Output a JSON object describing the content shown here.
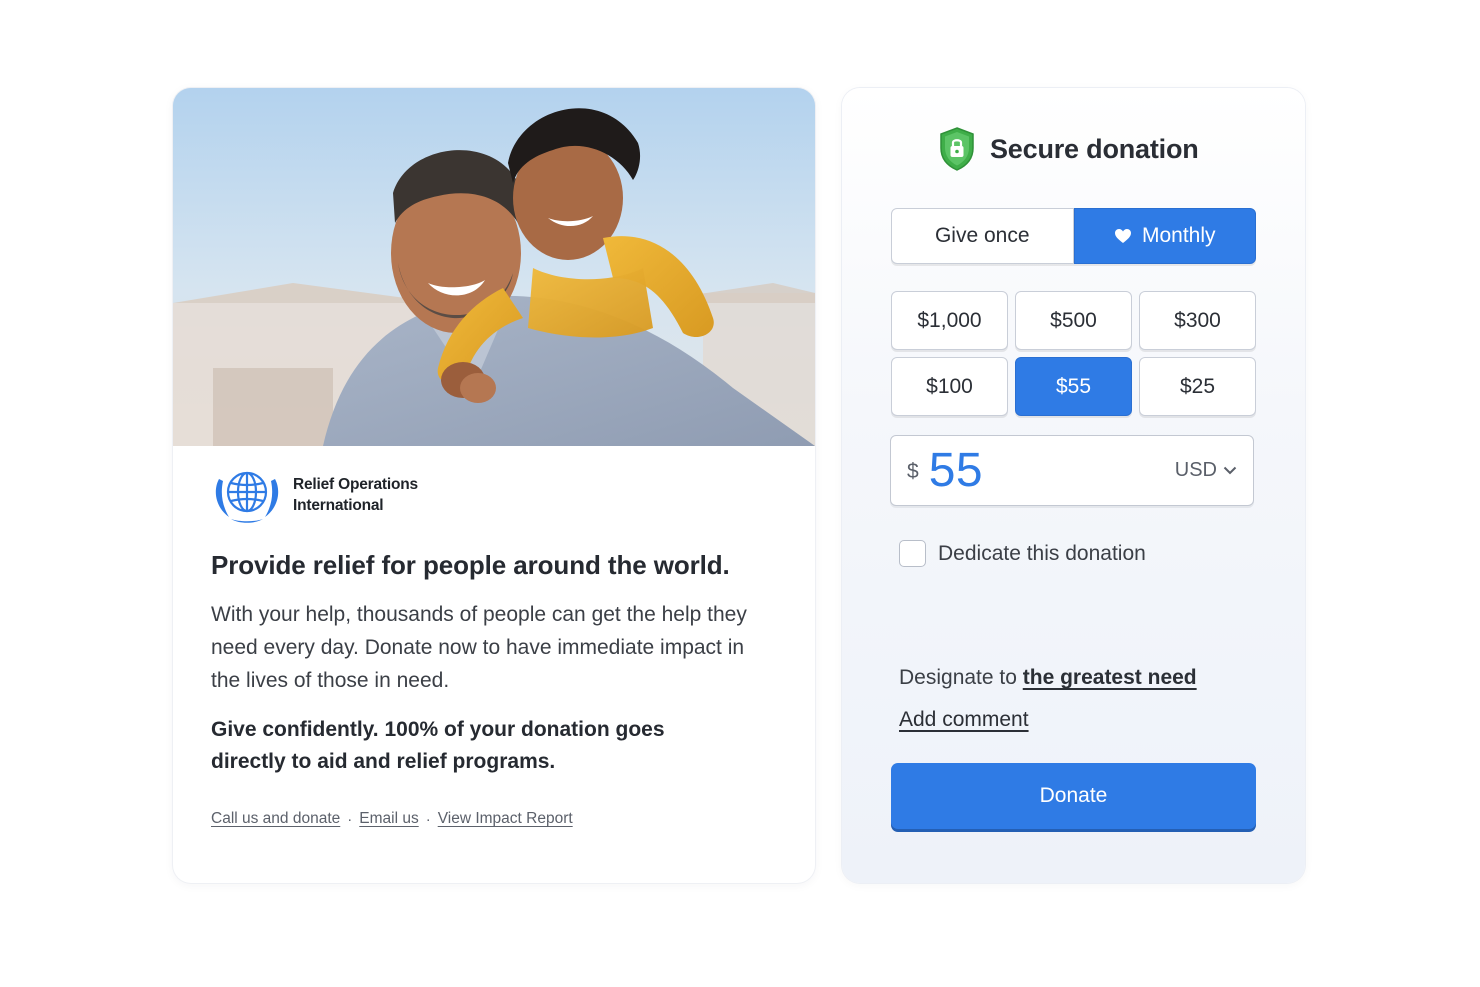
{
  "story": {
    "hero_alt": "Father carrying smiling son on his back",
    "org": {
      "line1": "Relief Operations",
      "line2": "International",
      "logo_icon": "globe-laurel-icon"
    },
    "headline": "Provide relief for people around the world.",
    "body": "With your help, thousands of people can get the help they need every day. Donate now to have immediate impact in the lives of those in need.",
    "emphasis": "Give confidently. 100% of your donation goes directly to aid and relief programs.",
    "links": [
      {
        "label": "Call us and donate"
      },
      {
        "label": "Email us"
      },
      {
        "label": "View Impact Report"
      }
    ],
    "link_separator": "·"
  },
  "donation": {
    "title": "Secure donation",
    "title_icon": "shield-lock-icon",
    "frequency": {
      "once_label": "Give once",
      "monthly_label": "Monthly",
      "monthly_icon": "heart-icon",
      "selected": "monthly"
    },
    "amounts": [
      "$1,000",
      "$500",
      "$300",
      "$100",
      "$55",
      "$25"
    ],
    "selected_amount": "$55",
    "input": {
      "currency_symbol": "$",
      "value": "55",
      "currency": "USD"
    },
    "dedicate_label": "Dedicate this donation",
    "dedicate_checked": false,
    "designate_prefix": "Designate to ",
    "designate_link": "the greatest need",
    "add_comment": "Add comment",
    "donate_label": "Donate"
  },
  "colors": {
    "accent": "#2f7be5",
    "shield": "#3fae49",
    "logo": "#2f7be5"
  }
}
